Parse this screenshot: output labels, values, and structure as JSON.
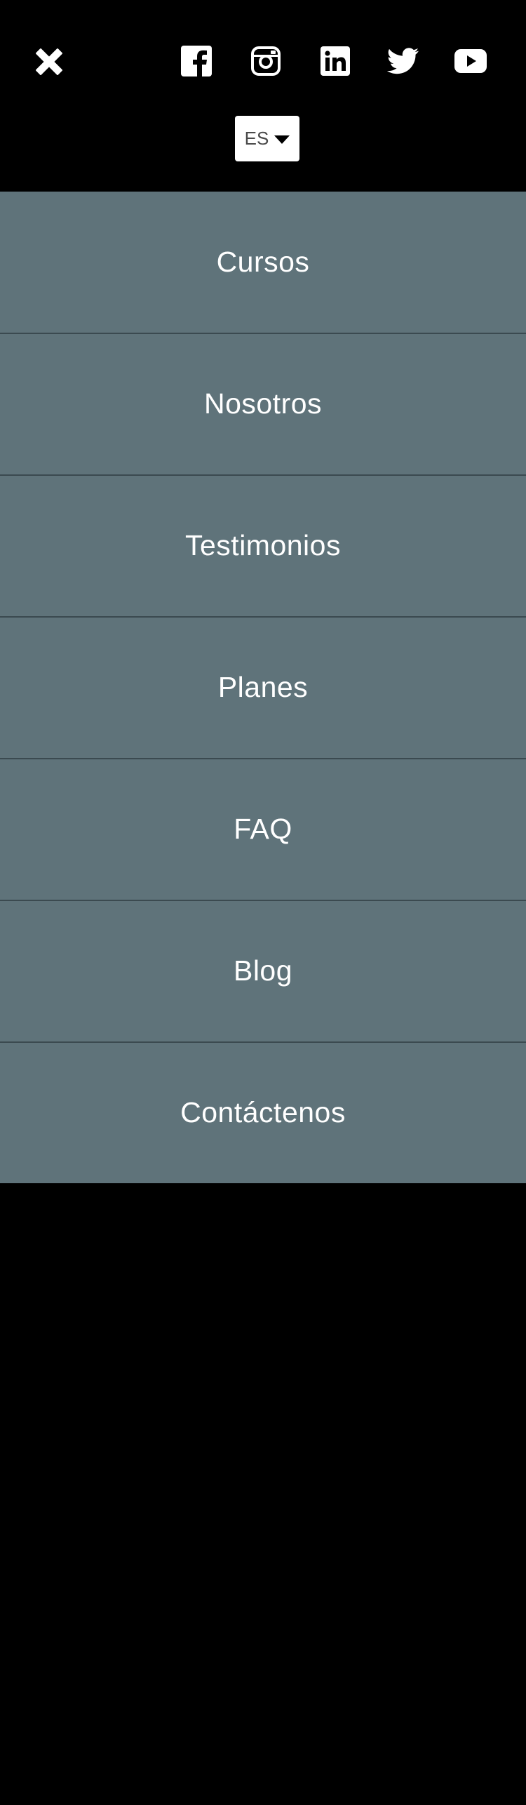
{
  "header": {
    "close_icon": "close-icon",
    "social_links": [
      {
        "name": "facebook",
        "icon": "facebook-icon"
      },
      {
        "name": "instagram",
        "icon": "instagram-icon"
      },
      {
        "name": "linkedin",
        "icon": "linkedin-icon"
      },
      {
        "name": "twitter",
        "icon": "twitter-icon"
      },
      {
        "name": "youtube",
        "icon": "youtube-icon"
      }
    ],
    "language": {
      "selected": "ES",
      "icon": "caret-down-icon"
    }
  },
  "menu": {
    "items": [
      {
        "label": "Cursos"
      },
      {
        "label": "Nosotros"
      },
      {
        "label": "Testimonios"
      },
      {
        "label": "Planes"
      },
      {
        "label": "FAQ"
      },
      {
        "label": "Blog"
      },
      {
        "label": "Contáctenos"
      }
    ]
  },
  "colors": {
    "background": "#000000",
    "menu_background": "#5f737a",
    "divider": "#3b4a50",
    "text": "#ffffff"
  }
}
